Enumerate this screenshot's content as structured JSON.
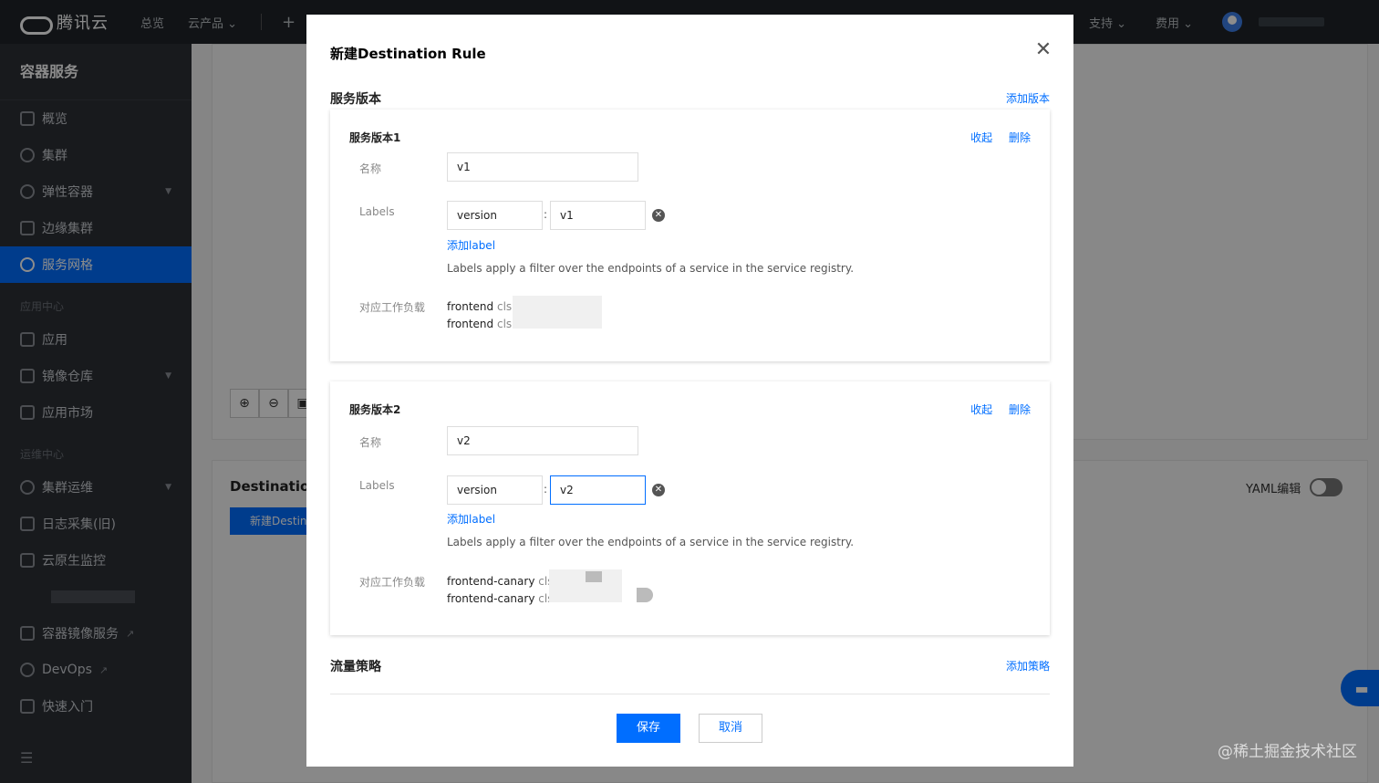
{
  "topbar": {
    "brand": "腾讯云",
    "nav": [
      "总览",
      "云产品 ⌄"
    ],
    "plus": "+",
    "right": [
      "支持 ⌄",
      "费用 ⌄"
    ]
  },
  "sidebar": {
    "title": "容器服务",
    "items_top": [
      {
        "label": "概览"
      },
      {
        "label": "集群"
      },
      {
        "label": "弹性容器"
      },
      {
        "label": "边缘集群"
      },
      {
        "label": "服务网格"
      }
    ],
    "group_app": "应用中心",
    "items_app": [
      {
        "label": "应用"
      },
      {
        "label": "镜像仓库"
      },
      {
        "label": "应用市场"
      }
    ],
    "group_ops": "运维中心",
    "items_ops": [
      {
        "label": "集群运维"
      },
      {
        "label": "日志采集(旧)"
      },
      {
        "label": "云原生监控"
      }
    ],
    "items_ext": [
      {
        "label": "容器镜像服务"
      },
      {
        "label": "DevOps"
      },
      {
        "label": "快速入门"
      }
    ],
    "bottom_icon": "☰"
  },
  "background": {
    "section_title": "Destination",
    "create_button": "新建Destin",
    "yaml_label": "YAML编辑"
  },
  "watermark": "@稀土掘金技术社区",
  "modal": {
    "title": "新建Destination Rule",
    "close": "✕",
    "service_versions": {
      "heading": "服务版本",
      "add_link": "添加版本",
      "cards": [
        {
          "title": "服务版本1",
          "collapse": "收起",
          "delete": "删除",
          "name_label": "名称",
          "name_value": "v1",
          "labels_label": "Labels",
          "label_key": "version",
          "label_value": "v1",
          "add_label": "添加label",
          "hint": "Labels apply a filter over the endpoints of a service in the service registry.",
          "workload_label": "对应工作负载",
          "workloads": [
            {
              "name": "frontend",
              "suffix": "cls"
            },
            {
              "name": "frontend",
              "suffix": "cls"
            }
          ]
        },
        {
          "title": "服务版本2",
          "collapse": "收起",
          "delete": "删除",
          "name_label": "名称",
          "name_value": "v2",
          "labels_label": "Labels",
          "label_key": "version",
          "label_value": "v2",
          "add_label": "添加label",
          "hint": "Labels apply a filter over the endpoints of a service in the service registry.",
          "workload_label": "对应工作负载",
          "workloads": [
            {
              "name": "frontend-canary",
              "suffix": "cls"
            },
            {
              "name": "frontend-canary",
              "suffix": "cls"
            }
          ]
        }
      ]
    },
    "traffic_policy": {
      "heading": "流量策略",
      "add_link": "添加策略"
    },
    "buttons": {
      "save": "保存",
      "cancel": "取消"
    }
  }
}
